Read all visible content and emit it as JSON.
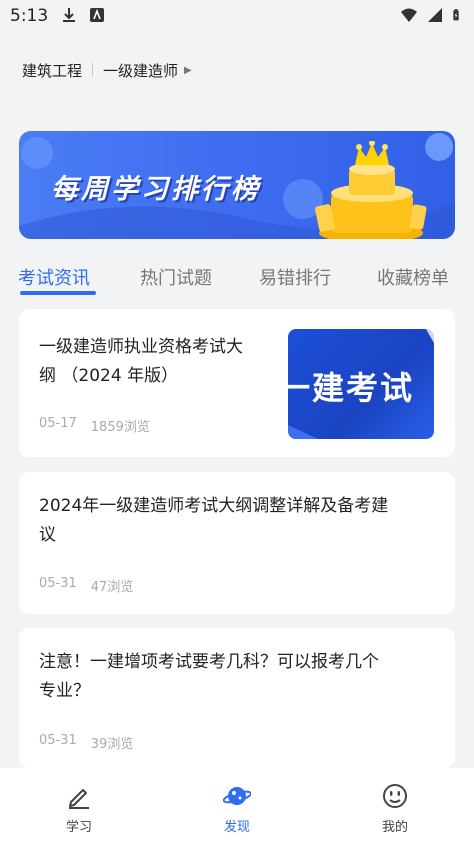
{
  "status_bar": {
    "time": "5:13",
    "left_icons": [
      "download-icon",
      "app-notification-icon"
    ],
    "right_icons": [
      "wifi-icon",
      "signal-icon",
      "battery-icon"
    ]
  },
  "breadcrumb": {
    "category": "建筑工程",
    "subcategory": "一级建造师"
  },
  "banner": {
    "title": "每周学习排行榜",
    "icon": "crown-trophy-icon"
  },
  "tabs": [
    {
      "label": "考试资讯",
      "active": true
    },
    {
      "label": "热门试题",
      "active": false
    },
    {
      "label": "易错排行",
      "active": false
    },
    {
      "label": "收藏榜单",
      "active": false
    }
  ],
  "articles": [
    {
      "title_line1": "一级建造师执业资格考试大",
      "title_line2": "纲  （2024 年版）",
      "date": "05-17",
      "views": "1859浏览",
      "thumbnail_text": "一建考试"
    },
    {
      "title_line1": "2024年一级建造师考试大纲调整详解及备考建",
      "title_line2": "议",
      "date": "05-31",
      "views": "47浏览"
    },
    {
      "title_line1": "注意！一建增项考试要考几科？可以报考几个",
      "title_line2": "专业？",
      "date": "05-31",
      "views": "39浏览"
    }
  ],
  "bottom_nav": [
    {
      "label": "学习",
      "icon": "pencil-icon",
      "active": false
    },
    {
      "label": "发现",
      "icon": "planet-icon",
      "active": true
    },
    {
      "label": "我的",
      "icon": "smiley-icon",
      "active": false
    }
  ],
  "colors": {
    "accent": "#2f6cf0",
    "background": "#f2f3f5",
    "banner": "#3f6cf0",
    "muted_text": "#aaaaaa"
  }
}
